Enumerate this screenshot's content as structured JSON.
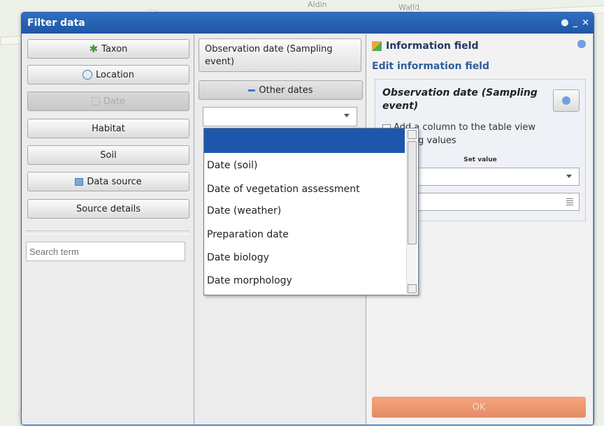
{
  "window": {
    "title": "Filter data"
  },
  "left": {
    "buttons": [
      {
        "label": "Taxon",
        "icon": "taxon-icon",
        "state": "normal"
      },
      {
        "label": "Location",
        "icon": "location-icon",
        "state": "normal"
      },
      {
        "label": "Date",
        "icon": "calendar-icon",
        "state": "disabled"
      },
      {
        "label": "Habitat",
        "state": "normal"
      },
      {
        "label": "Soil",
        "state": "normal"
      },
      {
        "label": "Data source",
        "icon": "database-icon",
        "state": "normal"
      },
      {
        "label": "Source details",
        "state": "normal"
      }
    ],
    "search_placeholder": "Search term"
  },
  "middle": {
    "observation_date_label": "Observation date (Sampling event)",
    "other_dates_label": "Other dates",
    "combo_value": ""
  },
  "dropdown": {
    "items": [
      "",
      "Date (soil)",
      "Date of vegetation assessment",
      "Date (weather)",
      "Preparation date",
      "Date biology",
      "Date morphology"
    ],
    "selected_index": 0
  },
  "info": {
    "header": "Information field",
    "subheader": "Edit information field",
    "field_title": "Observation date (Sampling event)",
    "checkbox_label_visible": "Add a column to the table view",
    "checkbox_label_line2_visible": "xisting values",
    "set_value_label": "Set value",
    "ok_label": "OK"
  },
  "map": {
    "labels": [
      "Aldin",
      "Walld"
    ]
  },
  "colors": {
    "title_bar": "#1f56a6",
    "ok_button": "#e58b63",
    "dropdown_highlight": "#1d57ab"
  }
}
